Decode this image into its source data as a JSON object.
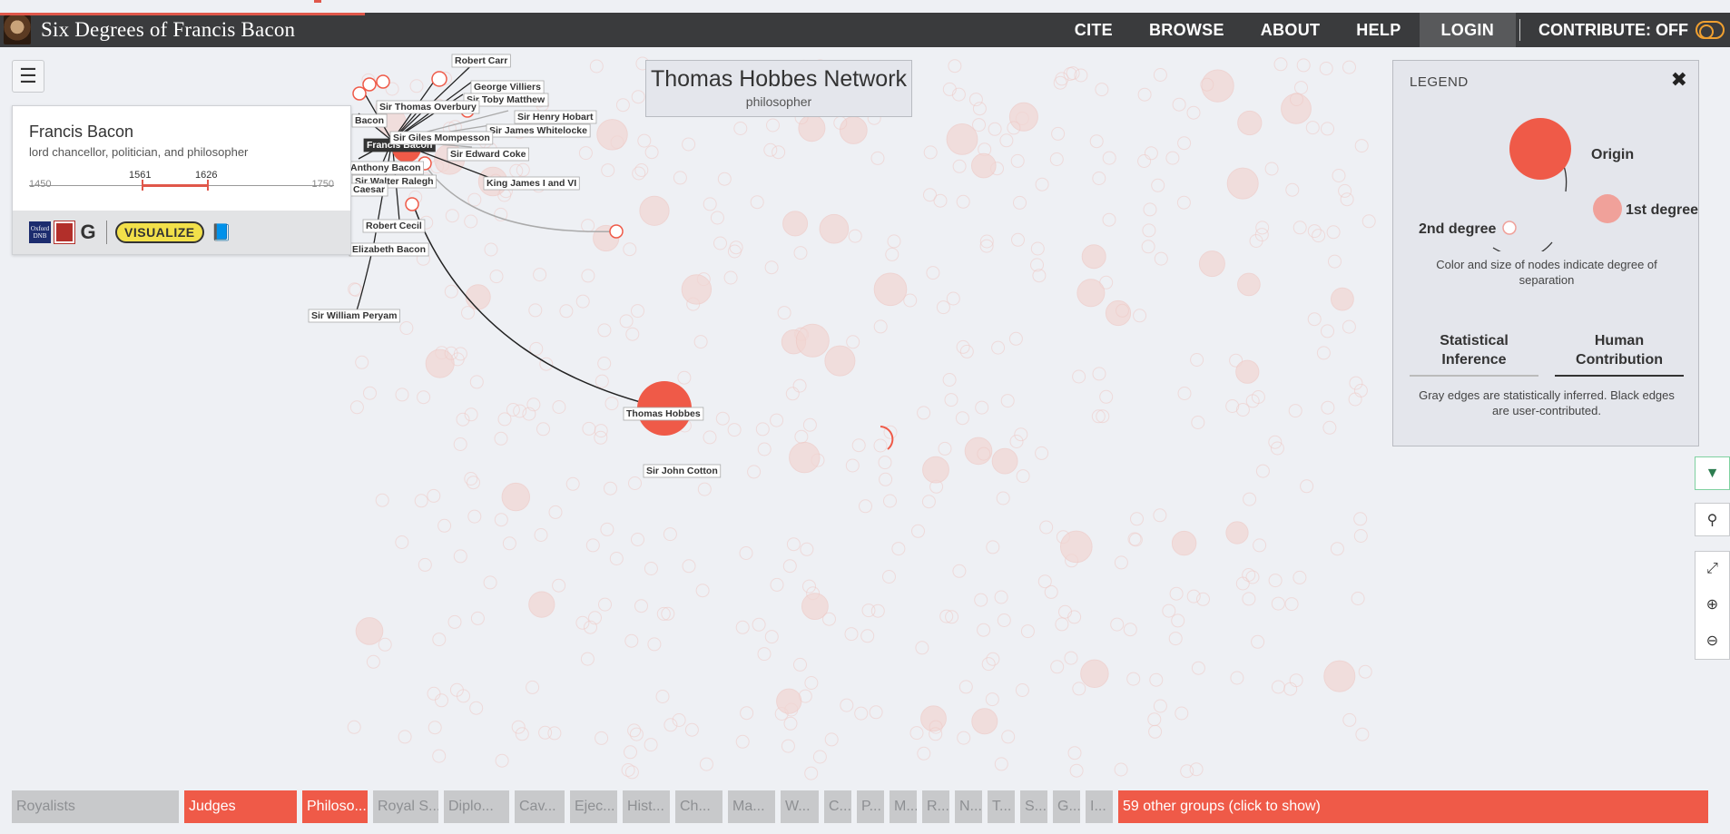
{
  "app": {
    "title": "Six Degrees of Francis Bacon",
    "nav": [
      "CITE",
      "BROWSE",
      "ABOUT",
      "HELP",
      "LOGIN"
    ],
    "contribute_label": "CONTRIBUTE: OFF"
  },
  "person_card": {
    "name": "Francis Bacon",
    "description": "lord chancellor, politician, and philosopher",
    "timeline": {
      "start_label": "1450",
      "end_label": "1750",
      "birth": "1561",
      "death": "1626"
    },
    "tools": {
      "odnb_label": "Oxford DNB",
      "google_label": "G",
      "visualize_label": "VISUALIZE"
    }
  },
  "network": {
    "title": "Thomas Hobbes Network",
    "subtitle": "philosopher",
    "nodes": [
      "Robert Carr",
      "George Villiers",
      "Sir Toby Matthew",
      "Sir Thomas Overbury",
      "Sir Henry Hobart",
      "Sir James Whitelocke",
      "Francis Bacon",
      "Sir Giles Mompesson",
      "Sir Edward Coke",
      "Anthony Bacon",
      "Sir Walter Ralegh",
      "Caesar",
      "King James I and VI",
      "Robert Cecil",
      "Elizabeth Bacon",
      "Sir William Peryam",
      "Thomas Hobbes",
      "Sir John Cotton",
      "Bacon"
    ],
    "colors": {
      "origin": "#ef5a48",
      "first_degree": "#f0a19a",
      "edge_user": "#222222",
      "edge_inferred": "#aaaaaa"
    }
  },
  "legend": {
    "header": "LEGEND",
    "labels": [
      "Origin",
      "1st degree",
      "2nd degree"
    ],
    "caption": "Color and size of nodes indicate degree of separation",
    "tabs": [
      "Statistical Inference",
      "Human Contribution"
    ],
    "note": "Gray edges are statistically inferred. Black edges are user-contributed."
  },
  "groups": {
    "items": [
      {
        "label": "Royalists",
        "on": false
      },
      {
        "label": "Judges",
        "on": true
      },
      {
        "label": "Philoso...",
        "on": true
      },
      {
        "label": "Royal S...",
        "on": false
      },
      {
        "label": "Diplo...",
        "on": false
      },
      {
        "label": "Cav...",
        "on": false
      },
      {
        "label": "Ejec...",
        "on": false
      },
      {
        "label": "Hist...",
        "on": false
      },
      {
        "label": "Ch...",
        "on": false
      },
      {
        "label": "Ma...",
        "on": false
      },
      {
        "label": "W...",
        "on": false
      },
      {
        "label": "C...",
        "on": false
      },
      {
        "label": "P...",
        "on": false
      },
      {
        "label": "M...",
        "on": false
      },
      {
        "label": "R...",
        "on": false
      },
      {
        "label": "N...",
        "on": false
      },
      {
        "label": "T...",
        "on": false
      },
      {
        "label": "S...",
        "on": false
      },
      {
        "label": "G...",
        "on": false
      },
      {
        "label": "I...",
        "on": false
      }
    ],
    "more_label": "59 other groups (click to show)"
  }
}
